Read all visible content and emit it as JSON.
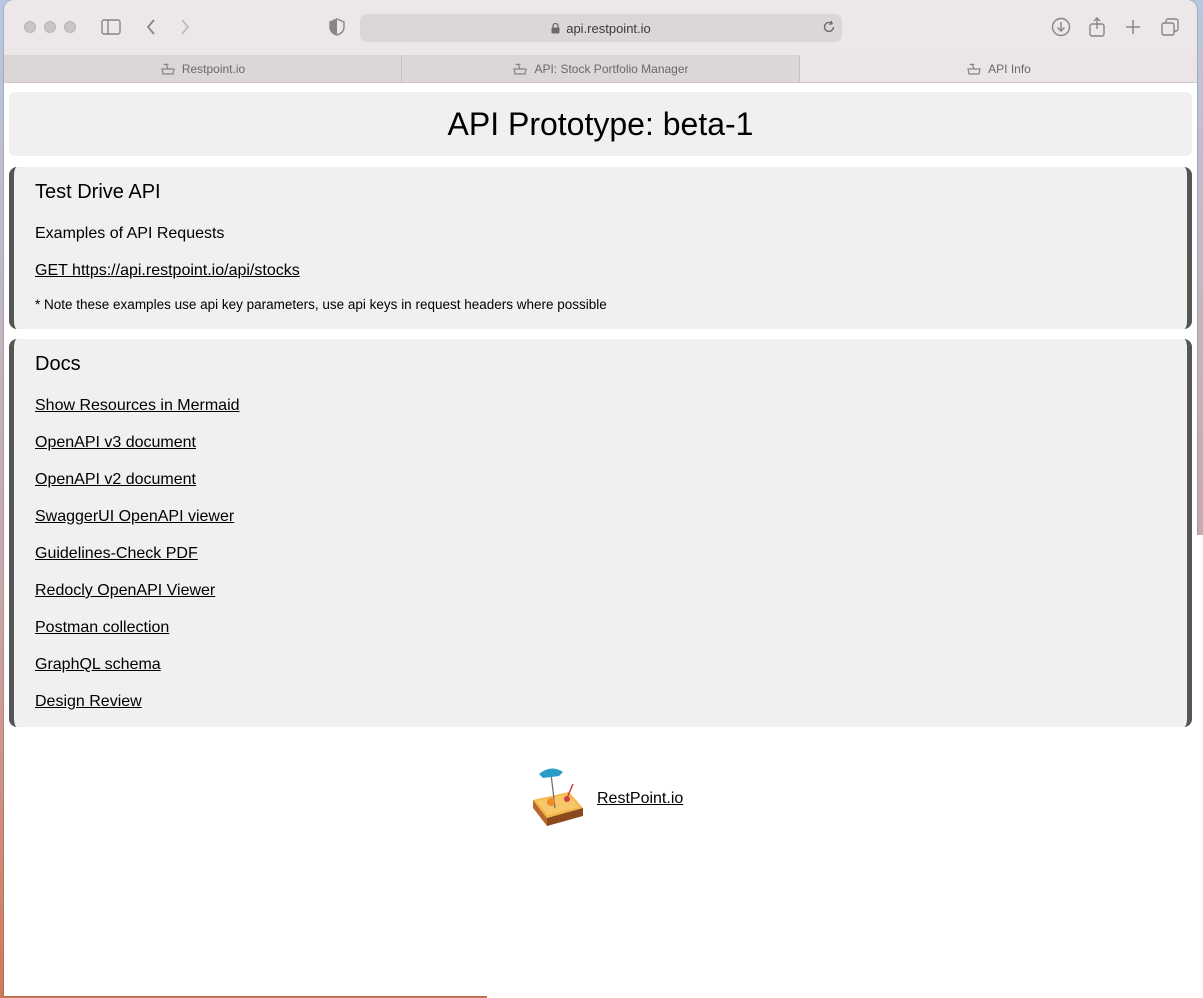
{
  "browser": {
    "url": "api.restpoint.io",
    "tabs": [
      {
        "label": "Restpoint.io",
        "active": false
      },
      {
        "label": "API: Stock Portfolio Manager",
        "active": false
      },
      {
        "label": "API Info",
        "active": true
      }
    ]
  },
  "page": {
    "title": "API Prototype: beta-1",
    "test_drive": {
      "heading": "Test Drive API",
      "subheading": "Examples of API Requests",
      "example_link": "GET https://api.restpoint.io/api/stocks",
      "note": "* Note these examples use api key parameters, use api keys in request headers where possible"
    },
    "docs": {
      "heading": "Docs",
      "links": [
        "Show Resources in Mermaid",
        "OpenAPI v3 document",
        "OpenAPI v2 document",
        "SwaggerUI OpenAPI viewer",
        "Guidelines-Check PDF",
        "Redocly OpenAPI Viewer",
        "Postman collection",
        "GraphQL schema",
        "Design Review"
      ]
    },
    "footer": {
      "link": "RestPoint.io"
    }
  }
}
